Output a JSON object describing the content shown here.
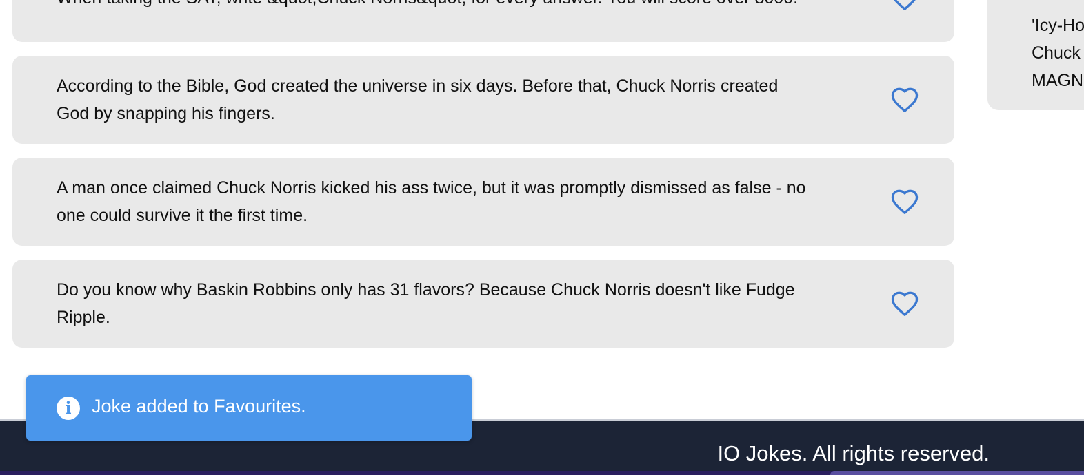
{
  "jokes": [
    {
      "text": "When taking the SAT, write &quot;Chuck Norris&quot; for every answer. You will score over 8000.",
      "favourite_icon": "heart-outline-icon"
    },
    {
      "text": "According to the Bible, God created the universe in six days. Before that, Chuck Norris created God by snapping his fingers.",
      "favourite_icon": "heart-outline-icon"
    },
    {
      "text": "A man once claimed Chuck Norris kicked his ass twice, but it was promptly dismissed as false - no one could survive it the first time.",
      "favourite_icon": "heart-outline-icon"
    },
    {
      "text": "Do you know why Baskin Robbins only has 31 flavors? Because Chuck Norris doesn't like Fudge Ripple.",
      "favourite_icon": "heart-outline-icon"
    }
  ],
  "side_card": {
    "text": "'Icy-Ho\nChuck\nMAGN"
  },
  "toast": {
    "icon": "info-icon",
    "icon_glyph": "i",
    "message": "Joke added to Favourites."
  },
  "footer": {
    "text": "IO Jokes. All rights reserved."
  },
  "colors": {
    "card_background": "#e9e9e9",
    "heart_outline": "#3b78d0",
    "toast_background": "#4a96eb",
    "footer_background": "#1c2436"
  }
}
